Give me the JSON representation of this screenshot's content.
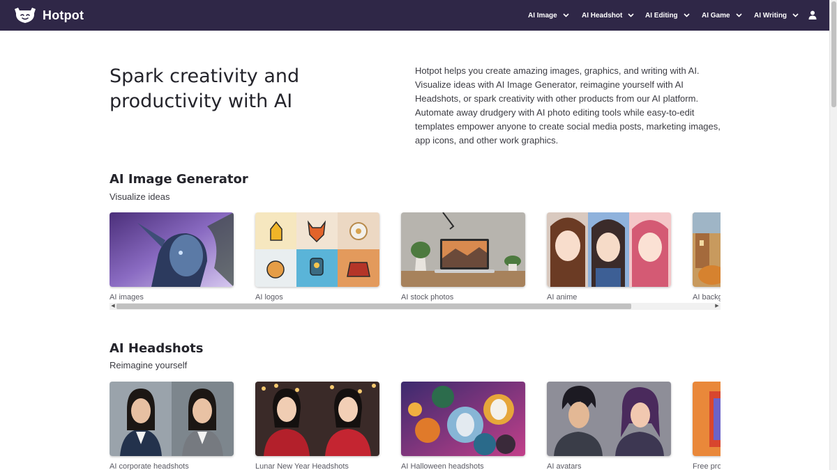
{
  "brand": {
    "name": "Hotpot"
  },
  "nav": {
    "items": [
      {
        "label": "AI Image"
      },
      {
        "label": "AI Headshot"
      },
      {
        "label": "AI Editing"
      },
      {
        "label": "AI Game"
      },
      {
        "label": "AI Writing"
      }
    ],
    "icons": {
      "dropdown": "chevron-down-icon",
      "account": "user-icon"
    }
  },
  "hero": {
    "title": "Spark creativity and productivity with AI",
    "description": "Hotpot helps you create amazing images, graphics, and writing with AI. Visualize ideas with AI Image Generator, reimagine yourself with AI Headshots, or spark creativity with other products from our AI platform. Automate away drudgery with AI photo editing tools while easy-to-edit templates empower anyone to create social media posts, marketing images, app icons, and other work graphics."
  },
  "sections": [
    {
      "title": "AI Image Generator",
      "subtitle": "Visualize ideas",
      "cards": [
        {
          "caption": "AI images"
        },
        {
          "caption": "AI logos"
        },
        {
          "caption": "AI stock photos"
        },
        {
          "caption": "AI anime"
        },
        {
          "caption": "AI backg"
        }
      ]
    },
    {
      "title": "AI Headshots",
      "subtitle": "Reimagine yourself",
      "cards": [
        {
          "caption": "AI corporate headshots"
        },
        {
          "caption": "Lunar New Year Headshots"
        },
        {
          "caption": "AI Halloween headshots"
        },
        {
          "caption": "AI avatars"
        },
        {
          "caption": "Free pro"
        }
      ]
    }
  ],
  "colors": {
    "nav_bg": "#2f2747",
    "text": "#24242b",
    "caption": "#5a5a63"
  }
}
